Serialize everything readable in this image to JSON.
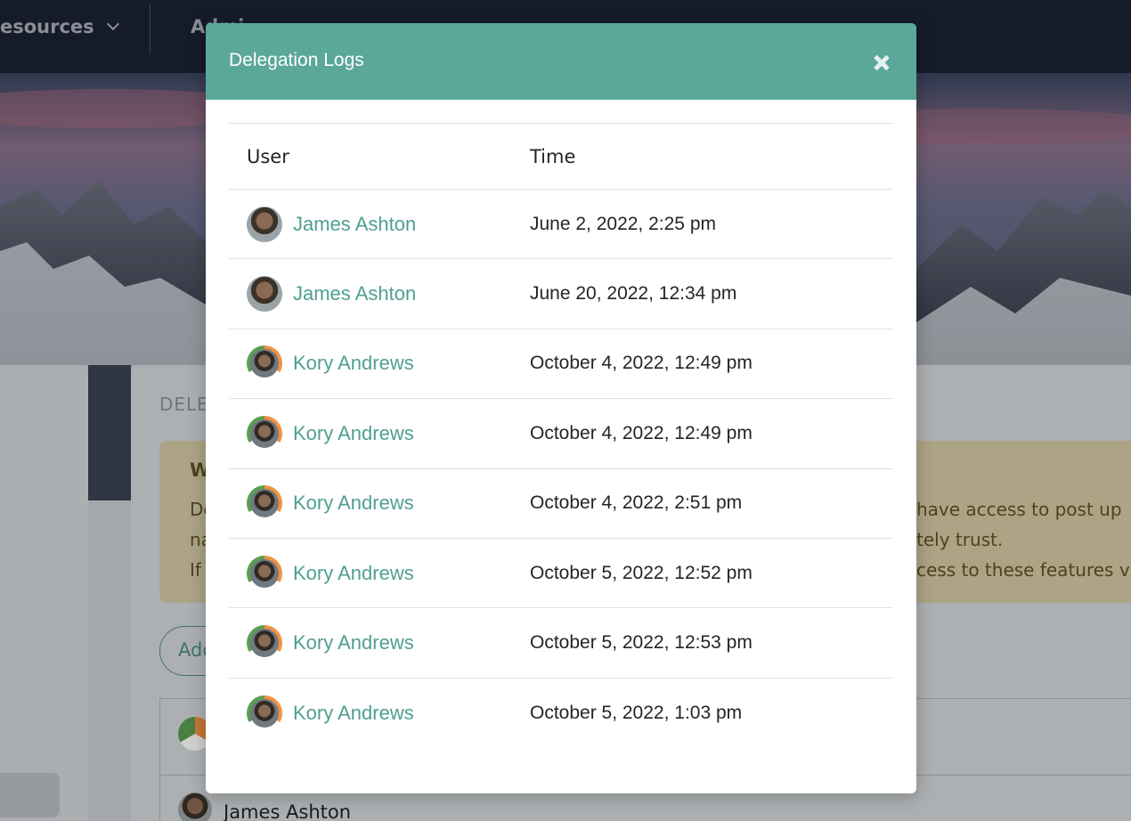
{
  "nav": {
    "resources_label": "esources",
    "admin_label": "Admi"
  },
  "background": {
    "section_title": "DELE",
    "warning_title": "W",
    "warning_lines": [
      {
        "left": "De",
        "right": "have access to post up"
      },
      {
        "left": "na",
        "right": "tely trust."
      },
      {
        "left": "If",
        "right": "cess to these features v"
      }
    ],
    "add_button_label": "Add",
    "bottom_row_name": "James Ashton"
  },
  "modal": {
    "title": "Delegation Logs",
    "close_label": "×",
    "columns": [
      "User",
      "Time"
    ],
    "rows": [
      {
        "user": "James Ashton",
        "avatar": "james",
        "time": "June 2, 2022, 2:25 pm"
      },
      {
        "user": "James Ashton",
        "avatar": "james",
        "time": "June 20, 2022, 12:34 pm"
      },
      {
        "user": "Kory Andrews",
        "avatar": "kory",
        "time": "October 4, 2022, 12:49 pm"
      },
      {
        "user": "Kory Andrews",
        "avatar": "kory",
        "time": "October 4, 2022, 12:49 pm"
      },
      {
        "user": "Kory Andrews",
        "avatar": "kory",
        "time": "October 4, 2022, 2:51 pm"
      },
      {
        "user": "Kory Andrews",
        "avatar": "kory",
        "time": "October 5, 2022, 12:52 pm"
      },
      {
        "user": "Kory Andrews",
        "avatar": "kory",
        "time": "October 5, 2022, 12:53 pm"
      },
      {
        "user": "Kory Andrews",
        "avatar": "kory",
        "time": "October 5, 2022, 1:03 pm"
      }
    ]
  },
  "colors": {
    "header_bg": "#5ba79a",
    "link": "#4f9f91",
    "nav_bg": "#1a2131"
  }
}
